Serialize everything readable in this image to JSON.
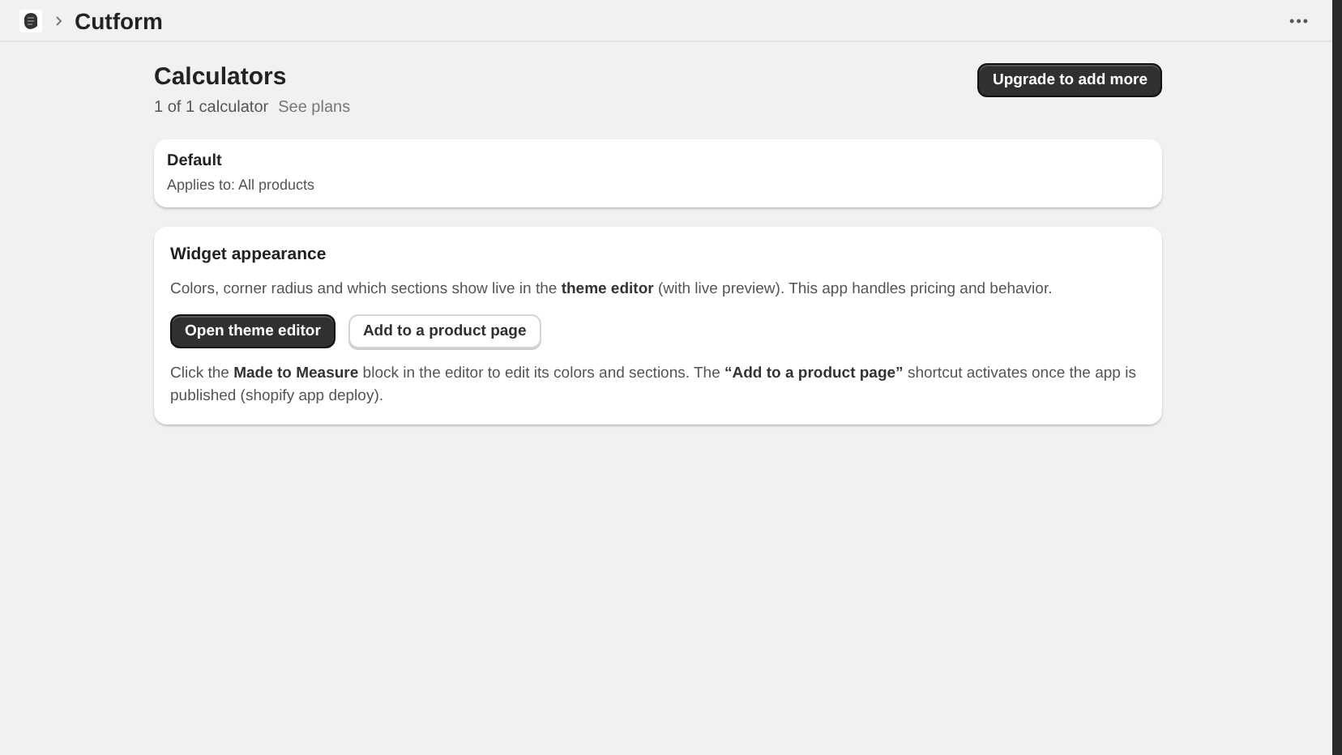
{
  "topbar": {
    "app_name": "Cutform",
    "more": "•••"
  },
  "header": {
    "title": "Calculators",
    "count": "1 of 1 calculator",
    "plans_link": "See plans",
    "upgrade_button": "Upgrade to add more"
  },
  "calculators": [
    {
      "name": "Default",
      "applies_to": "Applies to: All products"
    }
  ],
  "widget": {
    "title": "Widget appearance",
    "description": "Colors, corner radius and which sections show live in the **theme editor** (with live preview). This app handles pricing and behavior.",
    "buttons": [
      {
        "label": "Open theme editor",
        "kind": "primary"
      },
      {
        "label": "Add to a product page",
        "kind": "secondary"
      }
    ],
    "note": "Click the **Made to Measure** block in the editor to edit its colors and sections. The **“Add to a product page”** shortcut activates once the app is published (shopify app deploy)."
  }
}
